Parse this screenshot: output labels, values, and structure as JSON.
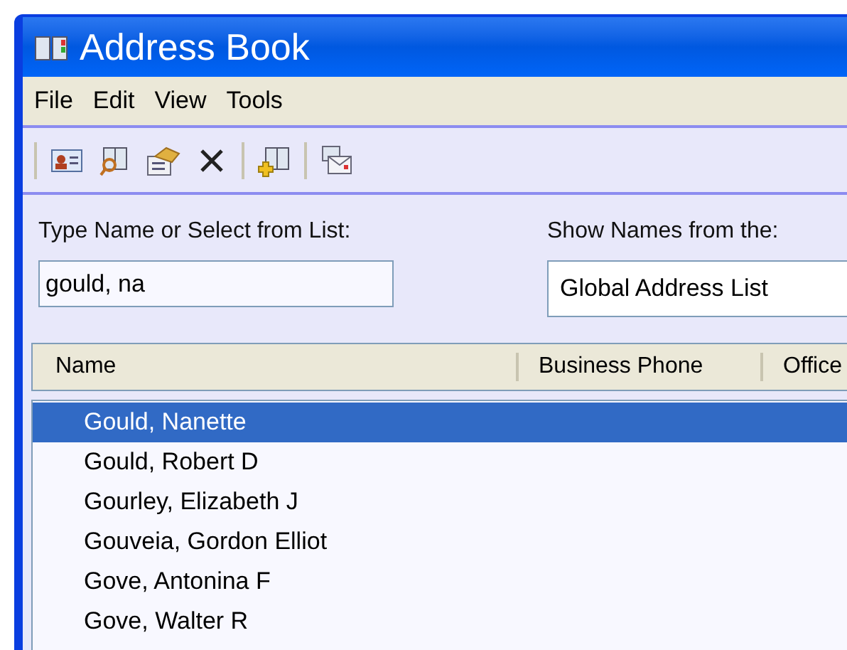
{
  "window": {
    "title": "Address Book"
  },
  "menu": [
    "File",
    "Edit",
    "View",
    "Tools"
  ],
  "search": {
    "label": "Type Name or Select from List:",
    "value": "gould, na"
  },
  "source": {
    "label": "Show Names from the:",
    "value": "Global Address List"
  },
  "table": {
    "columns": [
      "Name",
      "Business Phone",
      "Office"
    ],
    "rows": [
      {
        "name": "Gould, Nanette",
        "selected": true
      },
      {
        "name": "Gould, Robert D",
        "selected": false
      },
      {
        "name": "Gourley, Elizabeth J",
        "selected": false
      },
      {
        "name": "Gouveia, Gordon Elliot",
        "selected": false
      },
      {
        "name": "Gove, Antonina F",
        "selected": false
      },
      {
        "name": "Gove, Walter R",
        "selected": false
      }
    ]
  }
}
